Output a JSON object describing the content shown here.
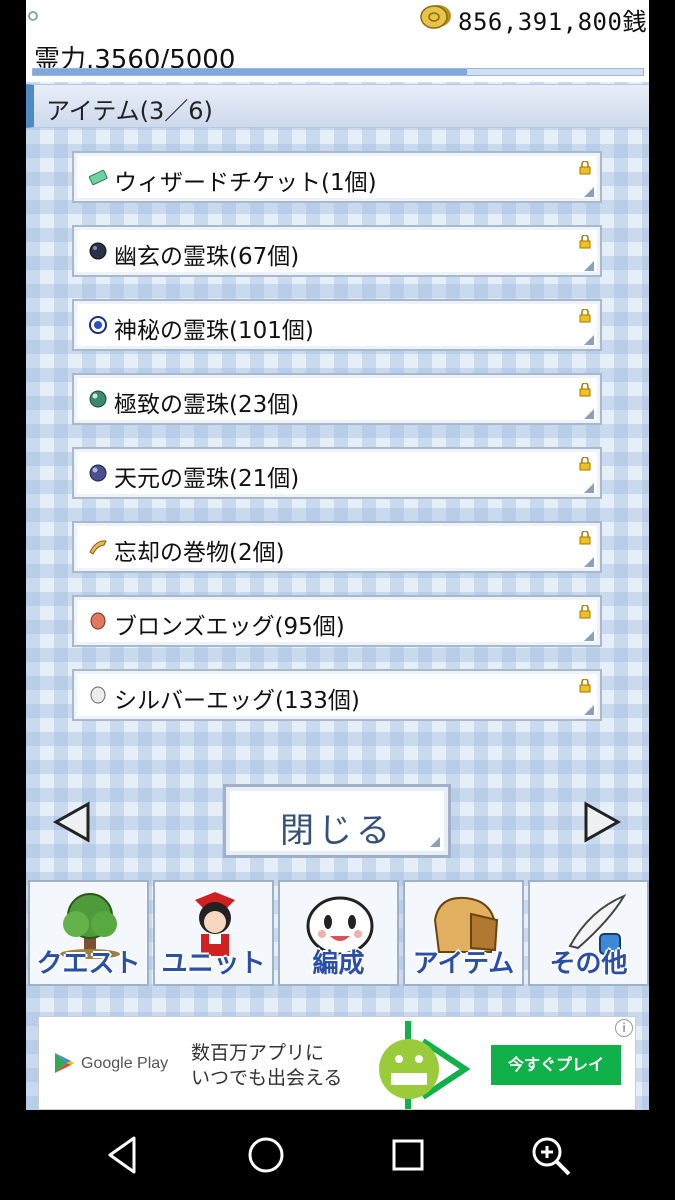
{
  "header": {
    "money": "856,391,800銭",
    "power_label": "霊力.3560/5000",
    "power_fraction": 0.712
  },
  "section": {
    "title": "アイテム(3／6)"
  },
  "items": [
    {
      "label": "ウィザードチケット(1個)",
      "icon": "ticket-icon",
      "color": "#6fd3a0"
    },
    {
      "label": "幽玄の霊珠(67個)",
      "icon": "dark-orb-icon",
      "color": "#2a2f4a"
    },
    {
      "label": "神秘の霊珠(101個)",
      "icon": "blue-orb-icon",
      "color": "#2b4fc4"
    },
    {
      "label": "極致の霊珠(23個)",
      "icon": "green-orb-icon",
      "color": "#3b8a6a"
    },
    {
      "label": "天元の霊珠(21個)",
      "icon": "purple-orb-icon",
      "color": "#4a4e8a"
    },
    {
      "label": "忘却の巻物(2個)",
      "icon": "scroll-icon",
      "color": "#d9a44a"
    },
    {
      "label": "ブロンズエッグ(95個)",
      "icon": "bronze-egg-icon",
      "color": "#e07a5f"
    },
    {
      "label": "シルバーエッグ(133個)",
      "icon": "silver-egg-icon",
      "color": "#dcdcdc"
    }
  ],
  "close_button": {
    "label": "閉じる"
  },
  "tabs": [
    {
      "label": "クエスト",
      "icon": "tree-icon"
    },
    {
      "label": "ユニット",
      "icon": "shrine-maiden-icon"
    },
    {
      "label": "編成",
      "icon": "yukkuri-face-icon"
    },
    {
      "label": "アイテム",
      "icon": "bag-icon"
    },
    {
      "label": "その他",
      "icon": "quill-ink-icon"
    }
  ],
  "ad": {
    "brand": "Google Play",
    "text_line1": "数百万アプリに",
    "text_line2": "いつでも出会える",
    "cta": "今すぐプレイ",
    "info": "i"
  },
  "colors": {
    "accent": "#4d89c4",
    "tab_text": "#2a4fa8",
    "cta": "#10b04a"
  }
}
